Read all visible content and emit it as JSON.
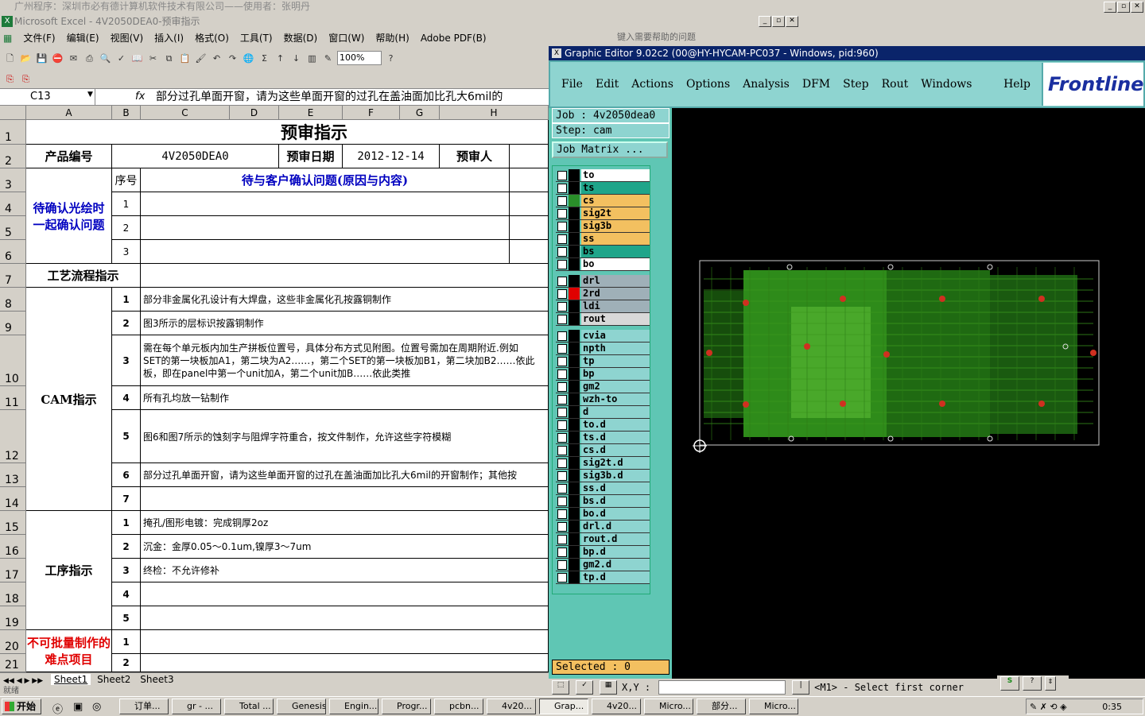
{
  "outer_title": "广州程序：深圳市必有德计算机软件技术有限公司——使用者：张明丹",
  "excel": {
    "title": "Microsoft Excel - 4V2050DEA0-预审指示",
    "help_placeholder": "键入需要帮助的问题",
    "menu": [
      "文件(F)",
      "编辑(E)",
      "视图(V)",
      "插入(I)",
      "格式(O)",
      "工具(T)",
      "数据(D)",
      "窗口(W)",
      "帮助(H)",
      "Adobe PDF(B)"
    ],
    "zoom": "100%",
    "cell_ref": "C13",
    "fx": "fx",
    "formula": "部分过孔单面开窗，请为这些单面开窗的过孔在盖油面加比孔大6mil的",
    "columns": [
      "A",
      "B",
      "C",
      "D",
      "E",
      "F",
      "G",
      "H"
    ],
    "rows": [
      "1",
      "2",
      "3",
      "4",
      "5",
      "6",
      "7",
      "8",
      "9",
      "10",
      "11",
      "12",
      "13",
      "14",
      "15",
      "16",
      "17",
      "18",
      "19",
      "20",
      "21"
    ],
    "sheet_title": "预审指示",
    "product_label": "产品编号",
    "product_value": "4V2050DEA0",
    "date_label": "预审日期",
    "date_value": "2012-12-14",
    "reviewer_label": "预审人",
    "confirm_section": "待确认光绘时一起确认问题",
    "seq_header": "序号",
    "confirm_header": "待与客户确认问题(原因与内容)",
    "confirm_nums": [
      "1",
      "2",
      "3"
    ],
    "flow_header": "工艺流程指示",
    "cam_label": "CAM指示",
    "cam_items": [
      {
        "n": "1",
        "t": "部分非金属化孔设计有大焊盘，这些非金属化孔按露铜制作"
      },
      {
        "n": "2",
        "t": "图3所示的层标识按露铜制作"
      },
      {
        "n": "3",
        "t1": "需在每个单元板内加生产拼板位置号，具体分布方式见附图。位置号需加在周期附近.例如",
        "t2": "SET的第一块板加A1，第二块为A2……，第二个SET的第一块板加B1，第二块加B2……依此",
        "t3": "板，即在panel中第一个unit加A，第二个unit加B……依此类推"
      },
      {
        "n": "4",
        "t": "所有孔均放一钻制作"
      },
      {
        "n": "5",
        "t": "图6和图7所示的蚀刻字与阻焊字符重合，按文件制作，允许这些字符模糊"
      },
      {
        "n": "6",
        "t": "部分过孔单面开窗，请为这些单面开窗的过孔在盖油面加比孔大6mil的开窗制作；其他按"
      },
      {
        "n": "7",
        "t": ""
      }
    ],
    "process_label": "工序指示",
    "process_items": [
      {
        "n": "1",
        "t": "掩孔/图形电镀：完成铜厚2oz"
      },
      {
        "n": "2",
        "t": "沉金：金厚0.05～0.1um,镍厚3～7um"
      },
      {
        "n": "3",
        "t": "终检：不允许修补"
      },
      {
        "n": "4",
        "t": ""
      },
      {
        "n": "5",
        "t": ""
      }
    ],
    "difficult_label": "不可批量制作的难点项目",
    "difficult_nums": [
      "1",
      "2"
    ],
    "sheets": [
      "Sheet1",
      "Sheet2",
      "Sheet3"
    ],
    "status": "就绪"
  },
  "ge": {
    "title": "Graphic Editor 9.02c2 (00@HY-HYCAM-PC037 - Windows, pid:960)",
    "menu": [
      "File",
      "Edit",
      "Actions",
      "Options",
      "Analysis",
      "DFM",
      "Step",
      "Rout",
      "Windows"
    ],
    "help": "Help",
    "logo": "Frontline",
    "job": "Job : 4v2050dea0",
    "step": "Step: cam",
    "job_matrix": "Job Matrix ...",
    "selected": "Selected : 0",
    "status_msg": "<M1> - Select first corner",
    "xy_label": "X,Y :",
    "layers_group1": [
      {
        "name": "to",
        "color": "#ffffff",
        "sw": "#000000"
      },
      {
        "name": "ts",
        "color": "#1fa58a",
        "sw": "#000000"
      },
      {
        "name": "cs",
        "color": "#f3c060",
        "sw": "#2a8f2a"
      },
      {
        "name": "sig2t",
        "color": "#f3c060",
        "sw": "#000000"
      },
      {
        "name": "sig3b",
        "color": "#f3c060",
        "sw": "#000000"
      },
      {
        "name": "ss",
        "color": "#f3c060",
        "sw": "#000000"
      },
      {
        "name": "bs",
        "color": "#1fa58a",
        "sw": "#000000"
      },
      {
        "name": "bo",
        "color": "#ffffff",
        "sw": "#000000"
      }
    ],
    "layers_group2": [
      {
        "name": "drl",
        "color": "#9fb0b8",
        "sw": "#000000"
      },
      {
        "name": "2rd",
        "color": "#9fb0b8",
        "sw": "#e00000"
      },
      {
        "name": "ldi",
        "color": "#9fb0b8",
        "sw": "#000000"
      },
      {
        "name": "rout",
        "color": "#d8d8d8",
        "sw": "#000000"
      }
    ],
    "layers_group3": [
      "cvia",
      "npth",
      "tp",
      "bp",
      "gm2",
      "wzh-to",
      "d",
      "to.d",
      "ts.d",
      "cs.d",
      "sig2t.d",
      "sig3b.d",
      "ss.d",
      "bs.d",
      "bo.d",
      "drl.d",
      "rout.d",
      "bp.d",
      "gm2.d",
      "tp.d"
    ],
    "board_color": "#2e8b1a"
  },
  "taskbar": {
    "start": "开始",
    "items": [
      "订单...",
      "gr - ...",
      "Total ...",
      "Genesis",
      "Engin...",
      "Progr...",
      "pcbn...",
      "4v20...",
      "Grap...",
      "4v20...",
      "Micro...",
      "部分...",
      "Micro..."
    ],
    "clock": "0:35"
  }
}
